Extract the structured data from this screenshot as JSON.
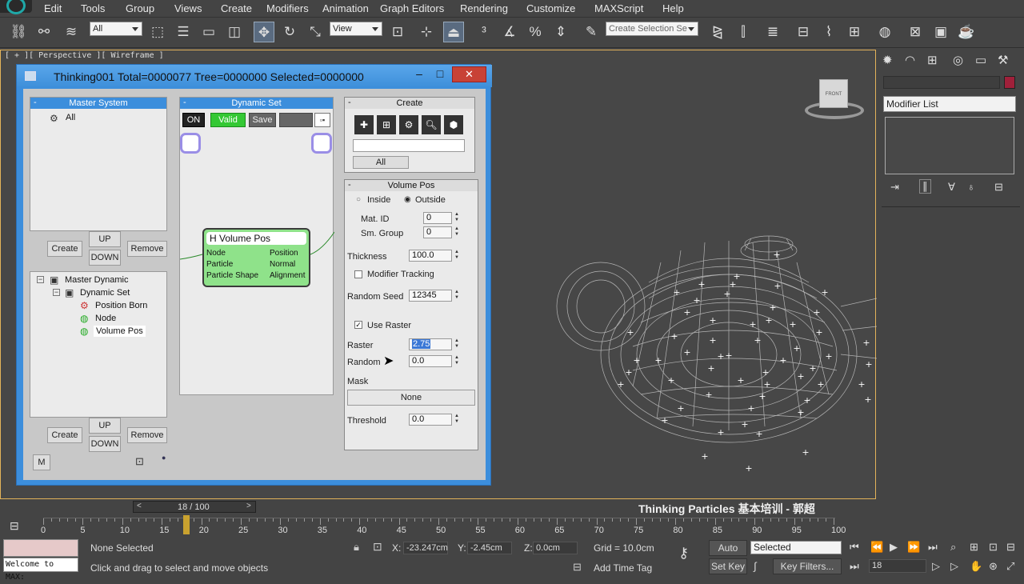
{
  "menu": {
    "items": [
      "Edit",
      "Tools",
      "Group",
      "Views",
      "Create",
      "Modifiers",
      "Animation",
      "Graph Editors",
      "Rendering",
      "Customize",
      "MAXScript",
      "Help"
    ]
  },
  "toolbar": {
    "filter_value": "All",
    "refcoord_value": "View",
    "selection_set_placeholder": "Create Selection Se"
  },
  "viewport": {
    "label": "[ + ][ Perspective ][ Wireframe ]",
    "viewcube_face": "FRONT"
  },
  "tp_window": {
    "title": "Thinking001  Total=0000077  Tree=0000000  Selected=0000000",
    "master_system": {
      "header": "Master System",
      "items": [
        "All"
      ]
    },
    "dynamic_set": {
      "header": "Dynamic Set",
      "on": "ON",
      "valid": "Valid",
      "save": "Save"
    },
    "buttons": {
      "create": "Create",
      "up": "UP",
      "down": "DOWN",
      "remove": "Remove",
      "m": "M"
    },
    "tree": [
      "Master Dynamic",
      "Dynamic Set",
      "Position Born",
      "Node",
      "Volume Pos"
    ],
    "node": {
      "title": "H Volume Pos",
      "left_ports": [
        "Node",
        "Particle",
        "Particle Shape"
      ],
      "right_ports": [
        "Position",
        "Normal",
        "Alignment"
      ]
    },
    "create_panel": {
      "header": "Create",
      "all": "All"
    },
    "volume_pos": {
      "header": "Volume Pos",
      "inside": "Inside",
      "outside": "Outside",
      "mat_id_label": "Mat. ID",
      "mat_id": "0",
      "sm_group_label": "Sm. Group",
      "sm_group": "0",
      "thickness_label": "Thickness",
      "thickness": "100.0",
      "modifier_tracking": "Modifier Tracking",
      "random_seed_label": "Random Seed",
      "random_seed": "12345",
      "use_raster": "Use Raster",
      "raster_label": "Raster",
      "raster": "2.75",
      "random_label": "Random",
      "random": "0.0",
      "mask_label": "Mask",
      "mask_value": "None",
      "threshold_label": "Threshold",
      "threshold": "0.0"
    }
  },
  "command_panel": {
    "modifier_list": "Modifier List",
    "accent_color": "#a0203a"
  },
  "timeline": {
    "frame_label": "18 / 100",
    "current_frame": 18,
    "ticks": [
      "0",
      "5",
      "10",
      "15",
      "20",
      "25",
      "30",
      "35",
      "40",
      "45",
      "50",
      "55",
      "60",
      "65",
      "70",
      "75",
      "80",
      "85",
      "90",
      "95",
      "100"
    ],
    "overlay_caption": "Thinking Particles 基本培训 - 郭超"
  },
  "status": {
    "welcome": "Welcome to MAX:",
    "selection": "None Selected",
    "prompt": "Click and drag to select and move objects",
    "x_label": "X:",
    "x_value": "-23.247cm",
    "y_label": "Y:",
    "y_value": "-2.45cm",
    "z_label": "Z:",
    "z_value": "0.0cm",
    "grid": "Grid = 10.0cm",
    "add_time_tag": "Add Time Tag",
    "auto_key": "Auto Key",
    "set_key": "Set Key",
    "key_mode": "Selected",
    "key_filters": "Key Filters...",
    "frame_field": "18"
  }
}
